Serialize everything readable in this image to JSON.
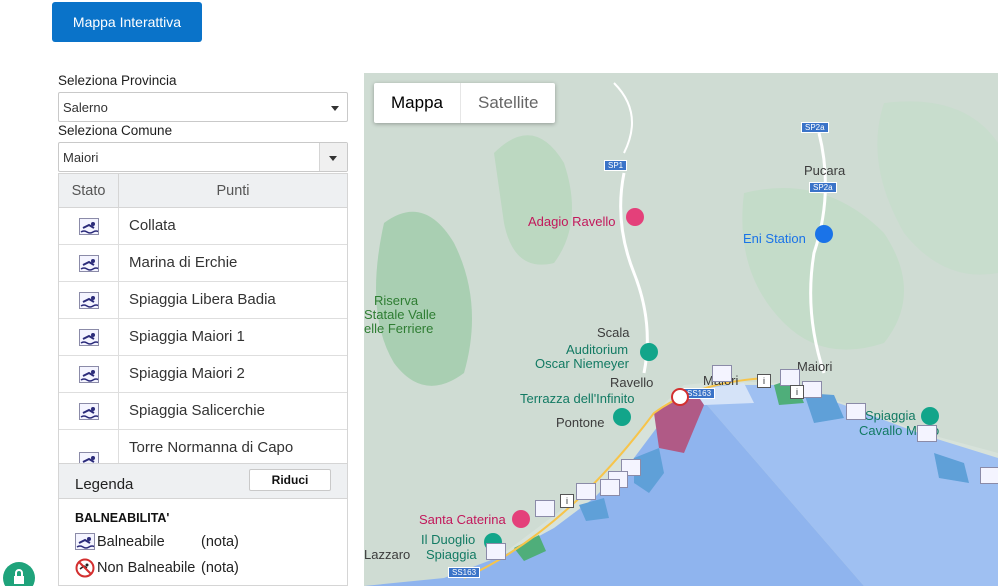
{
  "header": {
    "map_button": "Mappa Interattiva"
  },
  "filters": {
    "province_label": "Seleziona Provincia",
    "province_value": "Salerno",
    "comune_label": "Seleziona Comune",
    "comune_value": "Maiori"
  },
  "table": {
    "headers": {
      "stato": "Stato",
      "punti": "Punti"
    },
    "rows": [
      {
        "name": "Collata",
        "status_icon": "swimmer-icon"
      },
      {
        "name": "Marina di Erchie",
        "status_icon": "swimmer-icon"
      },
      {
        "name": "Spiaggia Libera Badia",
        "status_icon": "swimmer-icon"
      },
      {
        "name": "Spiaggia Maiori 1",
        "status_icon": "swimmer-icon"
      },
      {
        "name": "Spiaggia Maiori 2",
        "status_icon": "swimmer-icon"
      },
      {
        "name": "Spiaggia Salicerchie",
        "status_icon": "swimmer-icon"
      },
      {
        "name": "Torre Normanna di Capo d'Orso",
        "status_icon": "swimmer-icon"
      }
    ]
  },
  "legend": {
    "title": "Legenda",
    "collapse_button": "Riduci",
    "section_title": "BALNEABILITA'",
    "items": [
      {
        "label": "Balneabile",
        "note": "(nota)",
        "icon": "swimmer-icon"
      },
      {
        "label": "Non Balneabile",
        "note": "(nota)",
        "icon": "no-swimming-icon"
      }
    ]
  },
  "map": {
    "tabs": [
      {
        "label": "Mappa"
      },
      {
        "label": "Satellite"
      }
    ],
    "labels": {
      "adagio": "Adagio Ravello",
      "eni": "Eni Station",
      "pucara": "Pucara",
      "riserva1": "Riserva",
      "riserva2": "Statale Valle",
      "riserva3": "elle Ferriere",
      "scala": "Scala",
      "auditorium1": "Auditorium",
      "auditorium2": "Oscar Niemeyer",
      "ravello": "Ravello",
      "terrazza": "Terrazza dell'Infinito",
      "pontone": "Pontone",
      "maiori": "Maiori",
      "maiori_coast": "Maiori",
      "spiaggia_cm1": "Spiaggia",
      "spiaggia_cm2": "Cavallo Morto",
      "santa_caterina": "Santa Caterina",
      "duoglio1": "Il Duoglio",
      "duoglio2": "Spiaggia",
      "lazzaro": "Lazzaro"
    },
    "roads": [
      "SP1",
      "SP2a",
      "SP2a",
      "SS163",
      "SS163"
    ]
  }
}
